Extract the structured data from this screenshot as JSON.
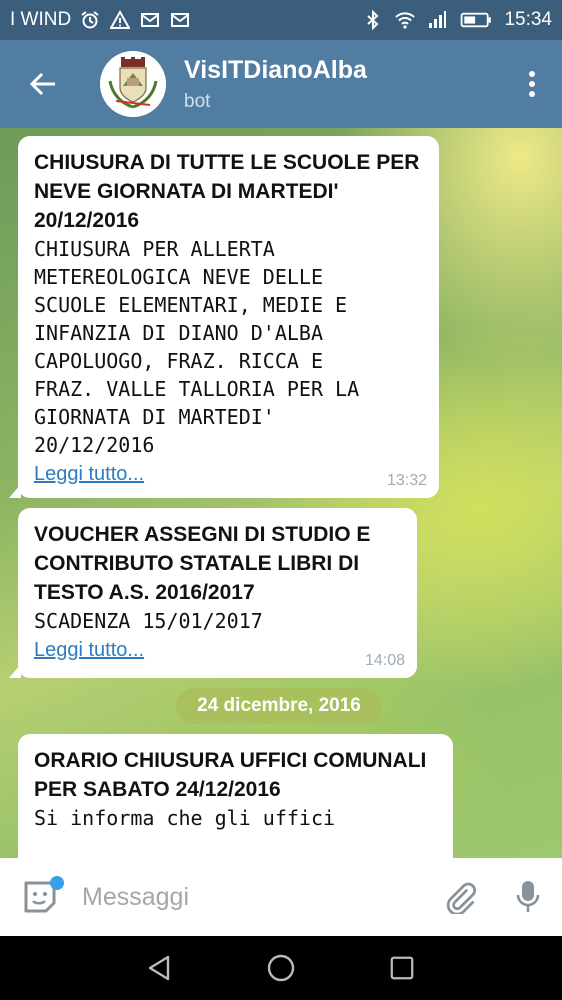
{
  "status_bar": {
    "carrier": "I WIND",
    "time": "15:34",
    "icons": [
      "alarm-icon",
      "warning-icon",
      "mail-icon",
      "mail-icon",
      "bluetooth-icon",
      "wifi-icon",
      "signal-icon",
      "battery-icon"
    ]
  },
  "header": {
    "title": "VisITDianoAlba",
    "subtitle": "bot"
  },
  "messages": [
    {
      "title": "CHIUSURA DI TUTTE LE SCUOLE PER NEVE GIORNATA DI MARTEDI' 20/12/2016",
      "body": "CHIUSURA PER ALLERTA\nMETEREOLOGICA NEVE DELLE\nSCUOLE ELEMENTARI, MEDIE E\nINFANZIA DI DIANO D'ALBA\nCAPOLUOGO, FRAZ. RICCA E\nFRAZ. VALLE TALLORIA PER LA\nGIORNATA DI MARTEDI'\n20/12/2016",
      "link": "Leggi tutto...",
      "time": "13:32"
    },
    {
      "title": "VOUCHER ASSEGNI DI STUDIO E CONTRIBUTO STATALE LIBRI DI TESTO A.S. 2016/2017",
      "body": "SCADENZA 15/01/2017",
      "link": "Leggi tutto...",
      "time": "14:08"
    },
    {
      "title": "ORARIO CHIUSURA UFFICI COMUNALI PER SABATO 24/12/2016",
      "body": "Si informa che gli uffici"
    }
  ],
  "date_separator": "24 dicembre, 2016",
  "input": {
    "placeholder": "Messaggi"
  },
  "colors": {
    "status_bar": "#3b5e7c",
    "app_bar": "#517da2",
    "link": "#2f7bc1",
    "badge_dot": "#3a9fe6"
  }
}
